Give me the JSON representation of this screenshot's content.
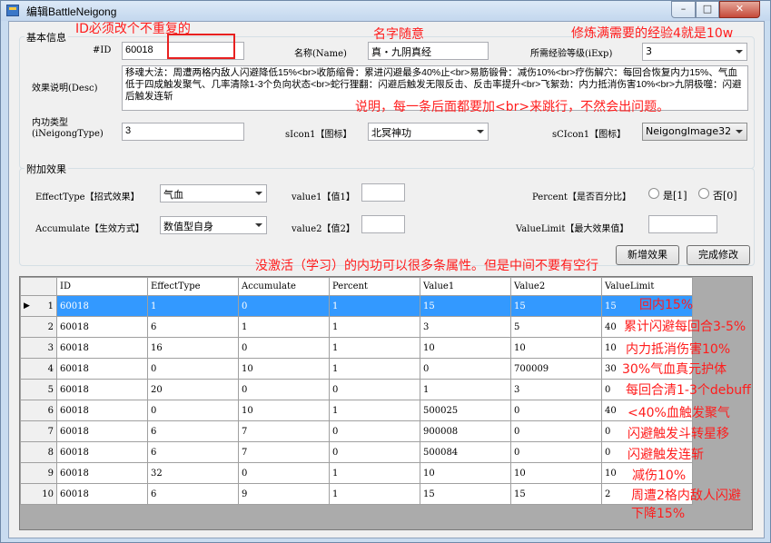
{
  "window": {
    "title": "编辑BattleNeigong",
    "min": "–",
    "max": "□",
    "close": "✕"
  },
  "basic": {
    "group_title": "基本信息",
    "id_label": "#ID",
    "id_value": "60018",
    "name_label": "名称(Name)",
    "name_value": "真・九阴真经",
    "exp_label": "所需经验等级(iExp)",
    "exp_value": "3",
    "desc_label": "效果说明(Desc)",
    "desc_value": "移魂大法：周遭两格内敌人闪避降低15%<br>收筋缩骨：累进闪避最多40%止<br>易筋锻骨：减伤10%<br>疗伤解穴：每回合恢复内力15%、气血低于四成触发聚气、几率清除1-3个负向状态<br>蛇行狸翻：闪避后触发无限反击、反击率提升<br>飞絮劲：内力抵消伤害10%<br>九阴极噬：闪避后触发连斩",
    "type_label1": "内功类型",
    "type_label2": "(iNeigongType)",
    "type_value": "3",
    "sicon_label": "sIcon1【图标】",
    "sicon_value": "北冥神功",
    "scicon_label": "sCIcon1【图标】",
    "scicon_value": "NeigongImage32"
  },
  "extra": {
    "group_title": "附加效果",
    "effecttype_label": "EffectType【招式效果】",
    "effecttype_value": "气血",
    "value1_label": "value1【值1】",
    "percent_label": "Percent【是否百分比】",
    "yes_label": "是[1]",
    "no_label": "否[0]",
    "accumulate_label": "Accumulate【生效方式】",
    "accumulate_value": "数值型自身",
    "value2_label": "value2【值2】",
    "valuelimit_label": "ValueLimit【最大效果值】",
    "add_button": "新增效果",
    "done_button": "完成修改"
  },
  "table": {
    "columns": [
      "ID",
      "EffectType",
      "Accumulate",
      "Percent",
      "Value1",
      "Value2",
      "ValueLimit"
    ],
    "rows": [
      [
        "1",
        "60018",
        "1",
        "0",
        "1",
        "15",
        "15",
        "15"
      ],
      [
        "2",
        "60018",
        "6",
        "1",
        "1",
        "3",
        "5",
        "40"
      ],
      [
        "3",
        "60018",
        "16",
        "0",
        "1",
        "10",
        "10",
        "10"
      ],
      [
        "4",
        "60018",
        "0",
        "10",
        "1",
        "0",
        "700009",
        "30"
      ],
      [
        "5",
        "60018",
        "20",
        "0",
        "0",
        "1",
        "3",
        "0"
      ],
      [
        "6",
        "60018",
        "0",
        "10",
        "1",
        "500025",
        "0",
        "40"
      ],
      [
        "7",
        "60018",
        "6",
        "7",
        "0",
        "900008",
        "0",
        "0"
      ],
      [
        "8",
        "60018",
        "6",
        "7",
        "0",
        "500084",
        "0",
        "0"
      ],
      [
        "9",
        "60018",
        "32",
        "0",
        "1",
        "10",
        "10",
        "10"
      ],
      [
        "10",
        "60018",
        "6",
        "9",
        "1",
        "15",
        "15",
        "2"
      ]
    ]
  },
  "annotations": {
    "id_note": "ID必须改个不重复的",
    "name_note": "名字随意",
    "exp_note": "修炼满需要的经验4就是10w",
    "desc_note": "说明，每一条后面都要加<br>来跳行，不然会出问题。",
    "multi_note": "没激活（学习）的内功可以很多条属性。但是中间不要有空行",
    "row_notes": [
      "回内15%",
      "累计闪避每回合3-5%",
      "内力抵消伤害10%",
      "30%气血真元护体",
      "每回合清1-3个debuff",
      "<40%血触发聚气",
      "闪避触发斗转星移",
      "闪避触发连斩",
      "减伤10%",
      "周遭2格内敌人闪避",
      "下降15%"
    ]
  },
  "colors": {
    "selection": "#3399ff",
    "annotation": "#ff1c1c"
  }
}
